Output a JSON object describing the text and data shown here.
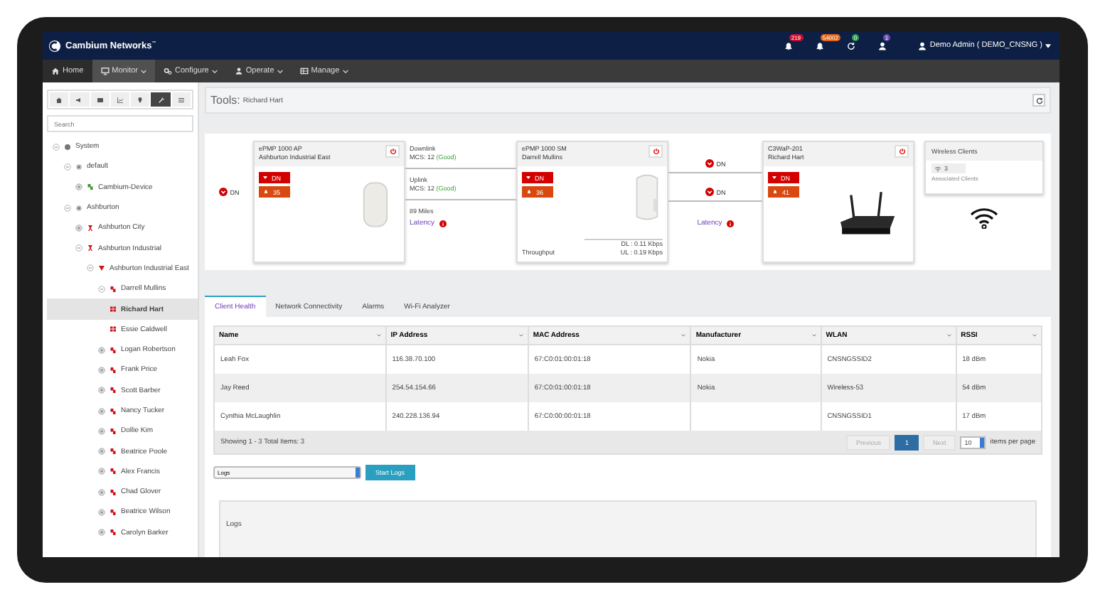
{
  "header": {
    "logo": "Cambium Networks",
    "logo_mark": "™",
    "badges": [
      {
        "kind": "bell",
        "count": "219",
        "color": "#c8102e"
      },
      {
        "kind": "bell",
        "count": "54002",
        "color": "#e0651a"
      },
      {
        "kind": "sync",
        "count": "0",
        "color": "#2e9e4f"
      },
      {
        "kind": "user",
        "count": "1",
        "color": "#6a4fb0"
      }
    ],
    "user": "Demo Admin ( DEMO_CNSNG )"
  },
  "menu": [
    {
      "kind": "home",
      "label": "Home",
      "selected": false,
      "dropdown": false
    },
    {
      "kind": "monitor",
      "label": "Monitor",
      "selected": true,
      "dropdown": true
    },
    {
      "kind": "gears",
      "label": "Configure",
      "selected": false,
      "dropdown": true
    },
    {
      "kind": "user",
      "label": "Operate",
      "selected": false,
      "dropdown": true
    },
    {
      "kind": "grid",
      "label": "Manage",
      "selected": false,
      "dropdown": true
    }
  ],
  "sidebar": {
    "tools": [
      {
        "kind": "home",
        "selected": false
      },
      {
        "kind": "megaphone",
        "selected": false
      },
      {
        "kind": "table",
        "selected": false
      },
      {
        "kind": "chart",
        "selected": false
      },
      {
        "kind": "pin",
        "selected": false
      },
      {
        "kind": "wrench",
        "selected": true
      },
      {
        "kind": "list",
        "selected": false
      }
    ],
    "search": {
      "placeholder": "Search"
    },
    "tree": [
      {
        "kind": "system",
        "label": "System",
        "expanded": true,
        "selected": false,
        "children": [
          {
            "kind": "network",
            "label": "default",
            "expanded": true,
            "selected": false,
            "children": [
              {
                "kind": "device",
                "label": "Cambium-Device",
                "expanded": false,
                "selected": false
              }
            ]
          },
          {
            "kind": "network",
            "label": "Ashburton",
            "expanded": true,
            "selected": false,
            "children": [
              {
                "kind": "tower",
                "label": "Ashburton City",
                "expanded": false,
                "selected": false
              },
              {
                "kind": "tower",
                "label": "Ashburton Industrial",
                "expanded": true,
                "selected": false,
                "children": [
                  {
                    "kind": "ap",
                    "label": "Ashburton Industrial East",
                    "expanded": true,
                    "selected": false,
                    "children": [
                      {
                        "kind": "sm",
                        "label": "Darrell Mullins",
                        "expanded": true,
                        "selected": false,
                        "children": [
                          {
                            "kind": "client",
                            "label": "Richard Hart",
                            "selected": true
                          },
                          {
                            "kind": "client",
                            "label": "Essie Caldwell",
                            "selected": false
                          }
                        ]
                      },
                      {
                        "kind": "sm",
                        "label": "Logan Robertson",
                        "expanded": false,
                        "selected": false
                      },
                      {
                        "kind": "sm",
                        "label": "Frank Price",
                        "expanded": false,
                        "selected": false
                      },
                      {
                        "kind": "sm",
                        "label": "Scott Barber",
                        "expanded": false,
                        "selected": false
                      },
                      {
                        "kind": "sm",
                        "label": "Nancy Tucker",
                        "expanded": false,
                        "selected": false
                      },
                      {
                        "kind": "sm",
                        "label": "Dollie Kim",
                        "expanded": false,
                        "selected": false
                      },
                      {
                        "kind": "sm",
                        "label": "Beatrice Poole",
                        "expanded": false,
                        "selected": false
                      },
                      {
                        "kind": "sm",
                        "label": "Alex Francis",
                        "expanded": false,
                        "selected": false
                      },
                      {
                        "kind": "sm",
                        "label": "Chad Glover",
                        "expanded": false,
                        "selected": false
                      },
                      {
                        "kind": "sm",
                        "label": "Beatrice Wilson",
                        "expanded": false,
                        "selected": false
                      },
                      {
                        "kind": "sm",
                        "label": "Carolyn Barker",
                        "expanded": false,
                        "selected": false
                      }
                    ]
                  }
                ]
              }
            ]
          }
        ]
      }
    ]
  },
  "tools_title": {
    "label": "Tools:",
    "name": "Richard Hart"
  },
  "topology": {
    "uplink": {
      "status": "DN"
    },
    "devices": [
      {
        "kind": "ap",
        "model": "ePMP 1000 AP",
        "name": "Ashburton Industrial East",
        "status": "DN",
        "alarms": "35"
      },
      {
        "kind": "sm",
        "model": "ePMP 1000 SM",
        "name": "Darrell Mullins",
        "status": "DN",
        "alarms": "36",
        "throughput": {
          "label": "Throughput",
          "dl": "DL : 0.11 Kbps",
          "ul": "UL : 0.19 Kbps"
        }
      },
      {
        "kind": "router",
        "model": "C3WaP-201",
        "name": "Richard Hart",
        "status": "DN",
        "alarms": "41"
      }
    ],
    "radio_link": {
      "downlink": "Downlink",
      "downlink_mcs": "MCS: 12",
      "downlink_quality": "(Good)",
      "uplink": "Uplink",
      "uplink_mcs": "MCS: 12",
      "uplink_quality": "(Good)",
      "distance": "89 Miles",
      "latency": "Latency"
    },
    "ethernet_link": {
      "status_top": "DN",
      "status_bottom": "DN",
      "latency": "Latency"
    },
    "wireless": {
      "title": "Wireless Clients",
      "count": "3",
      "caption": "Associated Clients"
    }
  },
  "tabs": [
    {
      "label": "Client Health",
      "selected": true
    },
    {
      "label": "Network Connectivity",
      "selected": false
    },
    {
      "label": "Alarms",
      "selected": false
    },
    {
      "label": "Wi-Fi Analyzer",
      "selected": false
    }
  ],
  "table": {
    "columns": [
      "Name",
      "IP Address",
      "MAC Address",
      "Manufacturer",
      "WLAN",
      "RSSI"
    ],
    "rows": [
      [
        "Leah Fox",
        "116.38.70.100",
        "67:C0:01:00:01:18",
        "Nokia",
        "CNSNGSSID2",
        "18 dBm"
      ],
      [
        "Jay Reed",
        "254.54.154.66",
        "67:C0:01:00:01:18",
        "Nokia",
        "Wireless-53",
        "54 dBm"
      ],
      [
        "Cynthia McLaughlin",
        "240.228.136.94",
        "67:C0:00:00:01:18",
        "",
        "CNSNGSSID1",
        "17 dBm"
      ]
    ],
    "summary": "Showing 1 - 3  Total Items: 3",
    "pager": {
      "previous": "Previous",
      "pages": [
        {
          "label": "1",
          "selected": true
        }
      ],
      "next": "Next",
      "page_size": "10",
      "page_size_label": "items per page"
    }
  },
  "logs": {
    "select": "Logs",
    "button": "Start Logs",
    "panel_title": "Logs"
  }
}
